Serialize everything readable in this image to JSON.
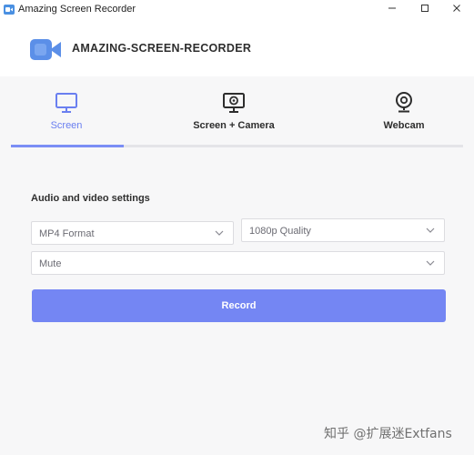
{
  "window": {
    "title": "Amazing Screen Recorder",
    "controls": {
      "minimize": "—",
      "maximize": "☐",
      "close": "✕"
    }
  },
  "header": {
    "brand_name": "AMAZING-SCREEN-RECORDER",
    "brand_icon": "video-camera-icon"
  },
  "tabs": [
    {
      "label": "Screen",
      "icon": "monitor-icon",
      "active": true
    },
    {
      "label": "Screen + Camera",
      "icon": "monitor-camera-icon",
      "active": false
    },
    {
      "label": "Webcam",
      "icon": "webcam-icon",
      "active": false
    }
  ],
  "progress": {
    "fraction": 0.25
  },
  "settings": {
    "title": "Audio and video settings",
    "format": "MP4 Format",
    "quality": "1080p Quality",
    "audio": "Mute",
    "record_label": "Record"
  },
  "watermark": "知乎 @扩展迷Extfans",
  "colors": {
    "accent": "#7486f3",
    "active_tab": "#6a7ff0",
    "track": "#e4e4e8"
  }
}
